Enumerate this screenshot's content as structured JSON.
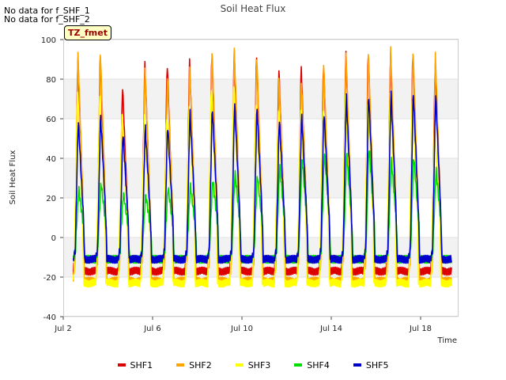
{
  "notes": [
    "No data for f_SHF_1",
    "No data for f_SHF_2"
  ],
  "tz_label": "TZ_fmet",
  "chart_data": {
    "type": "line",
    "title": "Soil Heat Flux",
    "xlabel": "Time",
    "ylabel": "Soil Heat Flux",
    "xlim": [
      "Jul 2",
      "Jul 19.7"
    ],
    "ylim": [
      -40,
      100
    ],
    "yticks": [
      -40,
      -20,
      0,
      20,
      40,
      60,
      80,
      100
    ],
    "xticks": [
      "Jul 2",
      "Jul 6",
      "Jul 10",
      "Jul 14",
      "Jul 18"
    ],
    "grid": "horizontal bands",
    "legend_position": "bottom",
    "series": [
      {
        "name": "SHF1",
        "color": "#dd0000",
        "daily_peaks": [
          93,
          94,
          78,
          90,
          90,
          91,
          95,
          96,
          94,
          87,
          88,
          90,
          95,
          96,
          95,
          95,
          90
        ],
        "night_min": -17
      },
      {
        "name": "SHF2",
        "color": "#ffa500",
        "daily_peaks": [
          93,
          95,
          58,
          87,
          82,
          86,
          96,
          95,
          93,
          80,
          80,
          88,
          94,
          95,
          96,
          96,
          93
        ],
        "night_min": -22
      },
      {
        "name": "SHF3",
        "color": "#ffff00",
        "daily_peaks": [
          75,
          73,
          65,
          62,
          63,
          66,
          78,
          77,
          69,
          66,
          65,
          67,
          72,
          71,
          73,
          72,
          57
        ],
        "night_min": -23
      },
      {
        "name": "SHF4",
        "color": "#00dd00",
        "daily_peaks": [
          25,
          28,
          23,
          22,
          26,
          27,
          30,
          33,
          32,
          37,
          41,
          44,
          43,
          47,
          40,
          42,
          35
        ],
        "night_min": -11
      },
      {
        "name": "SHF5",
        "color": "#0000cc",
        "daily_peaks": [
          60,
          63,
          54,
          57,
          58,
          65,
          67,
          69,
          67,
          61,
          63,
          65,
          73,
          74,
          75,
          75,
          74
        ],
        "night_min": -11
      }
    ]
  }
}
